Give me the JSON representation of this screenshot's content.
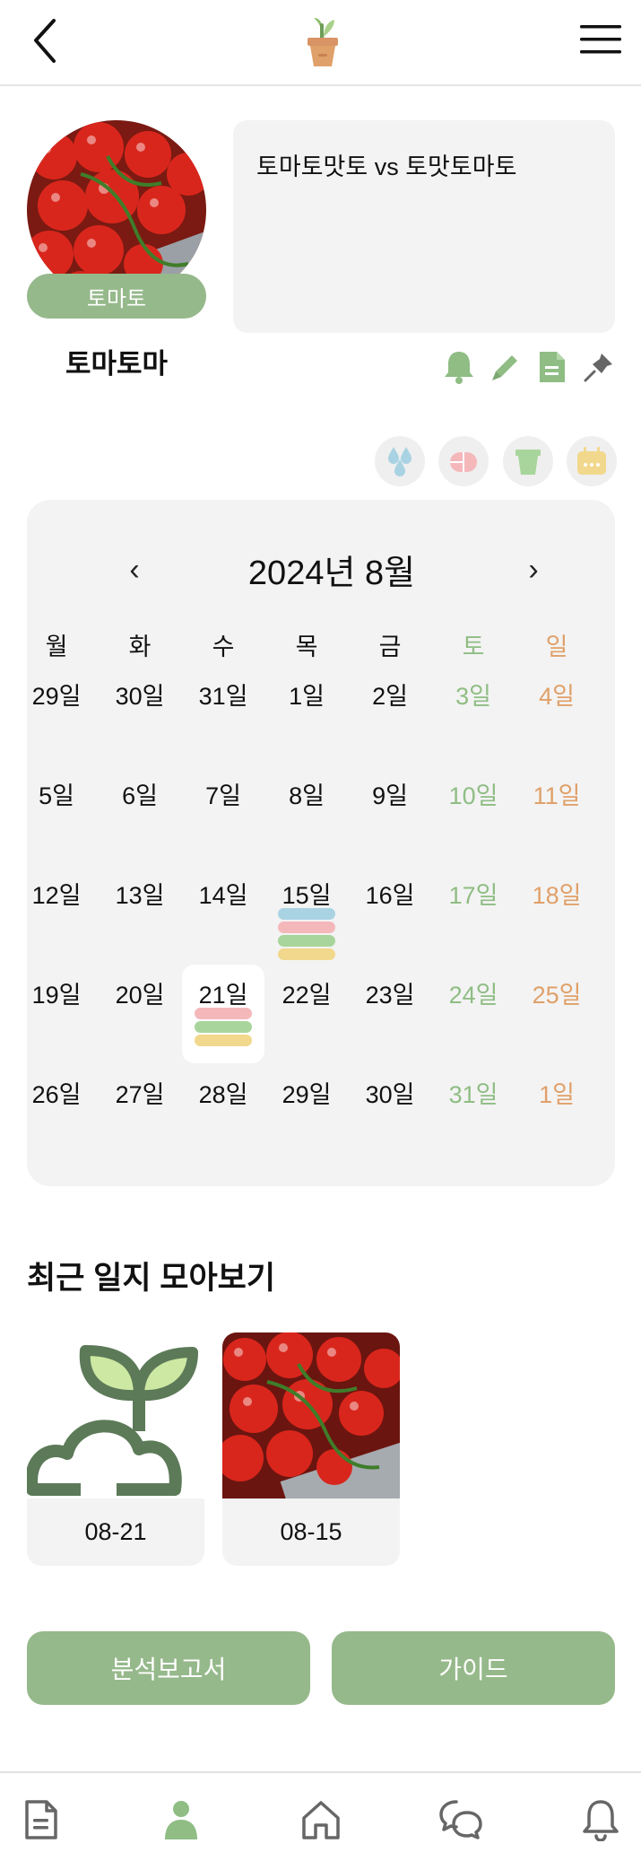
{
  "header": {
    "back_icon": "chevron-left-icon",
    "logo_icon": "potted-sprout-logo",
    "menu_icon": "hamburger-menu-icon"
  },
  "profile": {
    "species": "토마토",
    "name": "토마토마",
    "memo": "토마토맛토 vs 토맛토마토",
    "actions": [
      "bell-icon",
      "pencil-icon",
      "document-icon",
      "pin-icon"
    ]
  },
  "legend": [
    "water-icon",
    "pill-icon",
    "pot-icon",
    "calendar-icon"
  ],
  "calendar": {
    "title": "2024년 8월",
    "prev": "‹",
    "next": "›",
    "weekdays": [
      "월",
      "화",
      "수",
      "목",
      "금",
      "토",
      "일"
    ],
    "weeks": [
      [
        "29일",
        "30일",
        "31일",
        "1일",
        "2일",
        "3일",
        "4일"
      ],
      [
        "5일",
        "6일",
        "7일",
        "8일",
        "9일",
        "10일",
        "11일"
      ],
      [
        "12일",
        "13일",
        "14일",
        "15일",
        "16일",
        "17일",
        "18일"
      ],
      [
        "19일",
        "20일",
        "21일",
        "22일",
        "23일",
        "24일",
        "25일"
      ],
      [
        "26일",
        "27일",
        "28일",
        "29일",
        "30일",
        "31일",
        "1일"
      ]
    ],
    "today": "21일",
    "markers": {
      "15일": [
        "#a9d3e3",
        "#f4b8bb",
        "#a8d59b",
        "#f1d88c"
      ],
      "21일": [
        "#f4b8bb",
        "#a8d59b",
        "#f1d88c"
      ]
    },
    "colors": {
      "saturday": "#8fbd84",
      "sunday": "#e0a069"
    }
  },
  "recent": {
    "title": "최근 일지 모아보기",
    "logs": [
      {
        "date": "08-21",
        "thumb": "sprout-illustration"
      },
      {
        "date": "08-15",
        "thumb": "tomato-photo"
      }
    ]
  },
  "buttons": {
    "report": "분석보고서",
    "guide": "가이드"
  },
  "tabbar": [
    "document-icon",
    "profile-icon",
    "home-icon",
    "chat-icon",
    "bell-icon"
  ],
  "colors": {
    "accent": "#96b98b",
    "panel": "#f3f3f3"
  }
}
